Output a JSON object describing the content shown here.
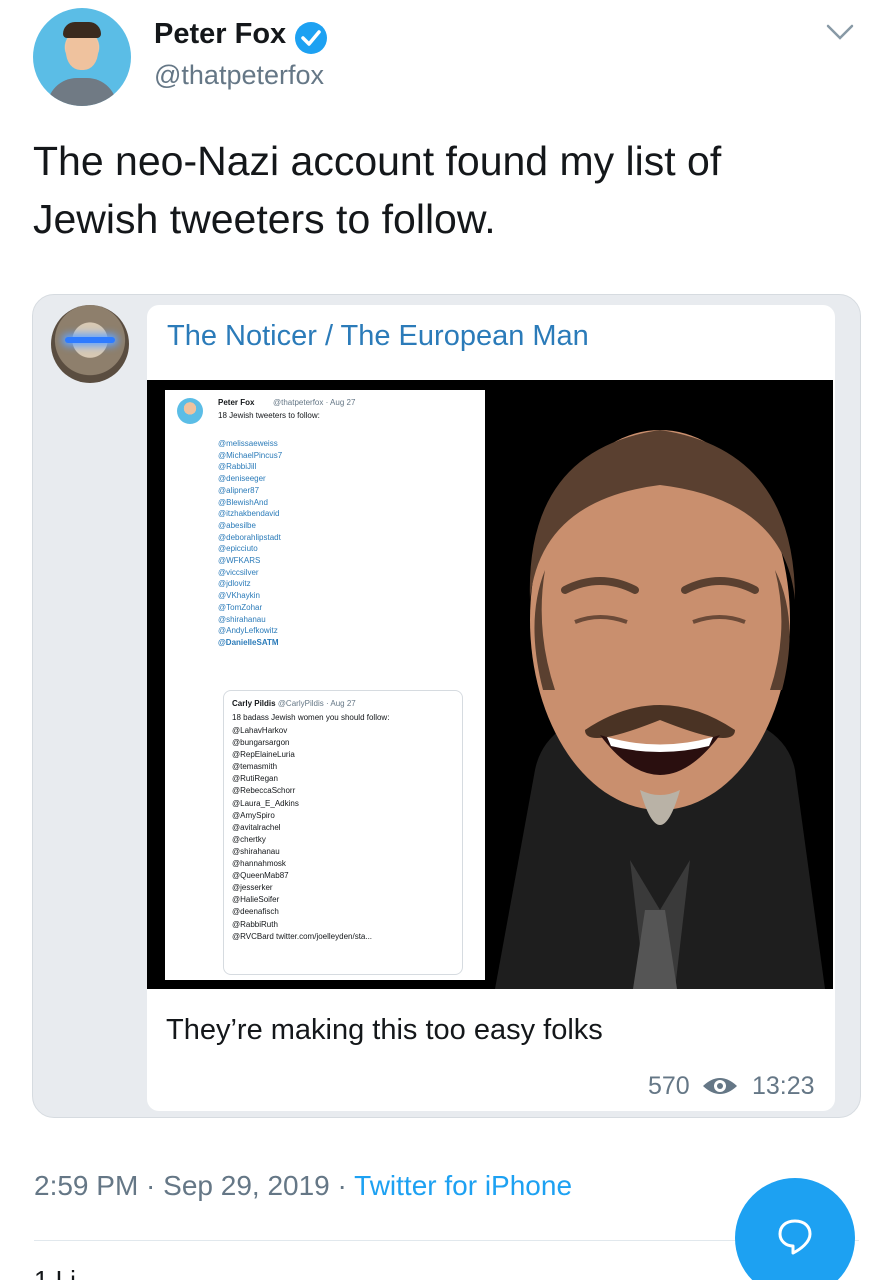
{
  "tweet": {
    "author_name": "Peter Fox",
    "author_handle": "@thatpeterfox",
    "text": "The neo-Nazi account found my list of Jewish tweeters to follow.",
    "timestamp": "2:59 PM · Sep 29, 2019 · ",
    "source": "Twitter for iPhone",
    "next_row": "1 Li"
  },
  "quote": {
    "author": "The Noticer / The European Man",
    "body": "They’re making this too easy folks",
    "views": "570",
    "time": "13:23"
  },
  "embedded_screenshot": {
    "name": "Peter Fox",
    "handle": "@thatpeterfox · Aug 27",
    "text": "18 Jewish tweeters to follow:",
    "handles": [
      "@melissaeweiss",
      "@MichaelPincus7",
      "@RabbiJill",
      "@deniseeger",
      "@alipner87",
      "@BlewishAnd",
      "@itzhakbendavid",
      "@abesilbe",
      "@deborahlipstadt",
      "@epicciuto",
      "@WFKARS",
      "@viccsilver",
      "@jdlovitz",
      "@VKhaykin",
      "@TomZohar",
      "@shirahanau",
      "@AndyLefkowitz",
      "@DanielleSATM"
    ],
    "quoted_name": "Carly Pildis",
    "quoted_handle": "@CarlyPildis · Aug 27",
    "quoted_text": "18 badass Jewish women you should follow:",
    "quoted_handles": [
      "@LahavHarkov",
      "@bungarsargon",
      "@RepElaineLuria",
      "@temasmith",
      "@RutiRegan",
      "@RebeccaSchorr",
      "@Laura_E_Adkins",
      "@AmySpiro",
      "@avitalrachel",
      "@chertky",
      "@shirahanau",
      "@hannahmosk",
      "@QueenMab87",
      "@jesserker",
      "@HalieSoifer",
      "@deenafisch",
      "@RabbiRuth",
      "@RVCBard twitter.com/joelleyden/sta..."
    ]
  },
  "colors": {
    "link": "#1da1f2",
    "quote_title": "#2b7bb9",
    "secondary": "#657786"
  },
  "icons": [
    "verified-badge-icon",
    "chevron-down-icon",
    "eye-icon",
    "reply-icon"
  ]
}
